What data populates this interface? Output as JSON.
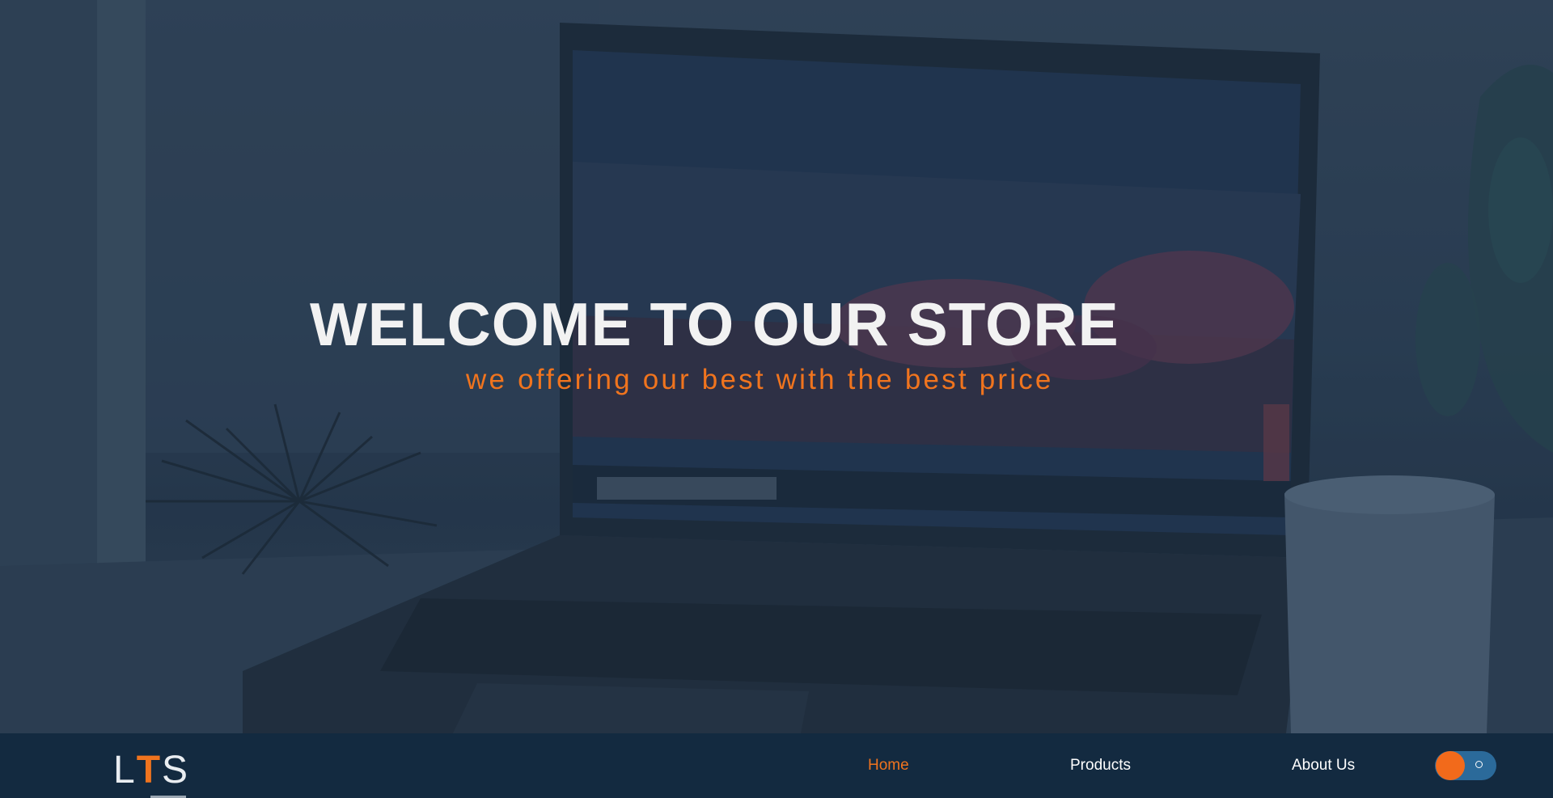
{
  "hero": {
    "title": "WELCOME TO OUR STORE",
    "subtitle": "we offering our best with the best price",
    "background_image": "laptop-on-desk-photo"
  },
  "navbar": {
    "logo": {
      "first": "L",
      "accent": "T",
      "last": "S"
    },
    "links": [
      {
        "label": "Home",
        "active": true
      },
      {
        "label": "Products",
        "active": false
      },
      {
        "label": "About Us",
        "active": false
      }
    ],
    "theme_toggle": {
      "icon": "moon-circle-icon",
      "state": "on"
    }
  },
  "colors": {
    "accent": "#f0741e",
    "navbar_bg": "#132a40",
    "title_text": "#f2f2f2",
    "toggle_track": "#2b6a9a"
  }
}
